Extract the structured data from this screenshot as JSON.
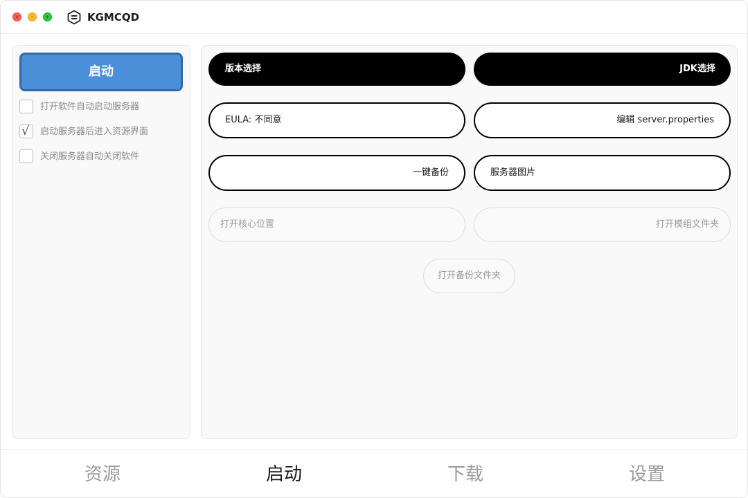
{
  "window": {
    "title": "KGMCQD",
    "controls": {
      "close_glyph": "×",
      "minimize_glyph": "−",
      "maximize_glyph": "+"
    }
  },
  "sidebar": {
    "start_button_label": "启动",
    "options": [
      {
        "label": "打开软件自动启动服务器",
        "checked": false
      },
      {
        "label": "启动服务器后进入资源界面",
        "checked": true
      },
      {
        "label": "关闭服务器自动关闭软件",
        "checked": false
      }
    ],
    "check_glyph": "√"
  },
  "main": {
    "version_select_label": "版本选择",
    "jdk_select_label": "JDK选择",
    "eula_label": "EULA: 不同意",
    "edit_properties_label": "编辑 server.properties",
    "one_click_backup_label": "一键备份",
    "server_icon_label": "服务器图片",
    "open_core_location_label": "打开核心位置",
    "open_mods_folder_label": "打开模组文件夹",
    "open_backup_folder_label": "打开备份文件夹"
  },
  "nav": {
    "tabs": [
      {
        "label": "资源",
        "active": false
      },
      {
        "label": "启动",
        "active": true
      },
      {
        "label": "下载",
        "active": false
      },
      {
        "label": "设置",
        "active": false
      }
    ]
  },
  "colors": {
    "accent": "#4a8fd8",
    "accent_border": "#2f6aa8",
    "primary_pill": "#000000"
  }
}
